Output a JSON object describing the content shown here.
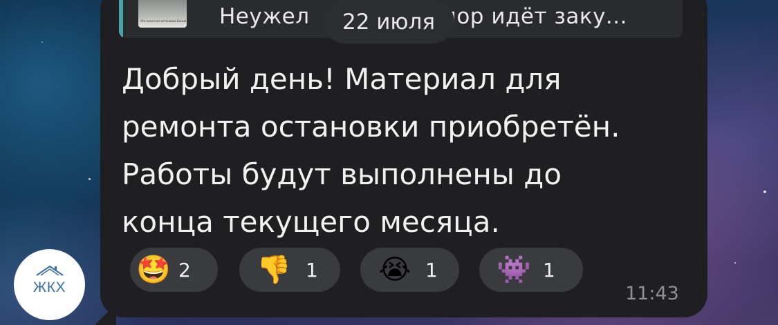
{
  "chat": {
    "date_separator": "22 июля",
    "reply_preview": {
      "text_before_date": "Неужел",
      "text_after_date": "пор идёт заку...",
      "thumb_caption": "Это конечная остановка Белый Угол."
    },
    "message": {
      "lines": [
        "Добрый день! Материал для",
        "ремонта остановки приобретён.",
        "Работы будут выполнены до",
        "конца текущего месяца."
      ],
      "time": "11:43"
    },
    "reactions": [
      {
        "emoji": "🤩",
        "icon": "star-struck-emoji-icon",
        "count": "2"
      },
      {
        "emoji": "👎",
        "icon": "thumbs-down-emoji-icon",
        "count": "1"
      },
      {
        "emoji": "😭",
        "icon": "crying-face-emoji-icon",
        "count": "1"
      },
      {
        "emoji": "👾",
        "icon": "alien-monster-emoji-icon",
        "count": "1"
      }
    ],
    "sender_avatar": {
      "label": "ЖКХ",
      "icon": "house-roof-icon"
    }
  },
  "colors": {
    "bubble": "#1f1f21",
    "reply_accent": "#4aa3a8",
    "reaction_bg": "#3a3b3e",
    "time_text": "#8e8e93",
    "avatar_label": "#3a6ea5"
  }
}
